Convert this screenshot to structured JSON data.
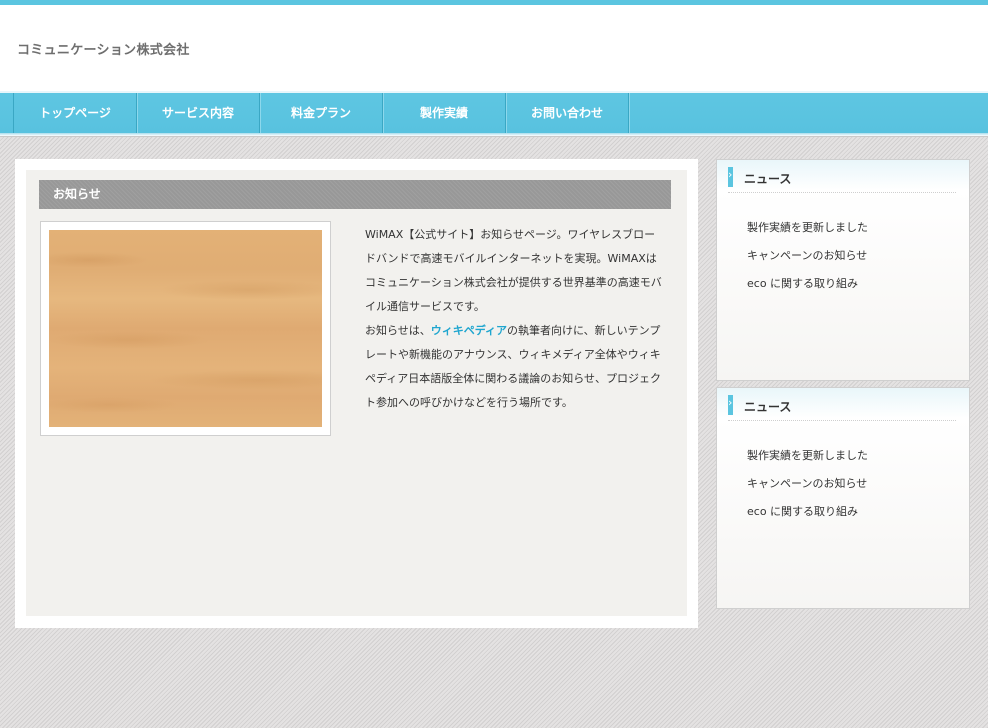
{
  "site": {
    "title": "コミュニケーション株式会社"
  },
  "nav": {
    "items": [
      "トップページ",
      "サービス内容",
      "料金プラン",
      "製作実績",
      "お問い合わせ"
    ]
  },
  "main": {
    "section_title": "お知らせ",
    "paragraph1": "WiMAX【公式サイト】お知らせページ。ワイヤレスブロードバンドで高速モバイルインターネットを実現。WiMAXはコミュニケーション株式会社が提供する世界基準の高速モバイル通信サービスです。",
    "paragraph2_prefix": "お知らせは、",
    "paragraph2_link": "ウィキペディア",
    "paragraph2_suffix": "の執筆者向けに、新しいテンプレートや新機能のアナウンス、ウィキメディア全体やウィキペディア日本語版全体に関わる議論のお知らせ、プロジェクト参加への呼びかけなどを行う場所です。"
  },
  "sidebar": {
    "boxes": [
      {
        "title": "ニュース",
        "items": [
          "製作実績を更新しました",
          "キャンペーンのお知らせ",
          "eco に関する取り組み"
        ]
      },
      {
        "title": "ニュース",
        "items": [
          "製作実績を更新しました",
          "キャンペーンのお知らせ",
          "eco に関する取り組み"
        ]
      }
    ]
  },
  "colors": {
    "accent": "#5bc5e0",
    "link": "#1fa6cf",
    "section_bar": "#a0a0a0"
  }
}
